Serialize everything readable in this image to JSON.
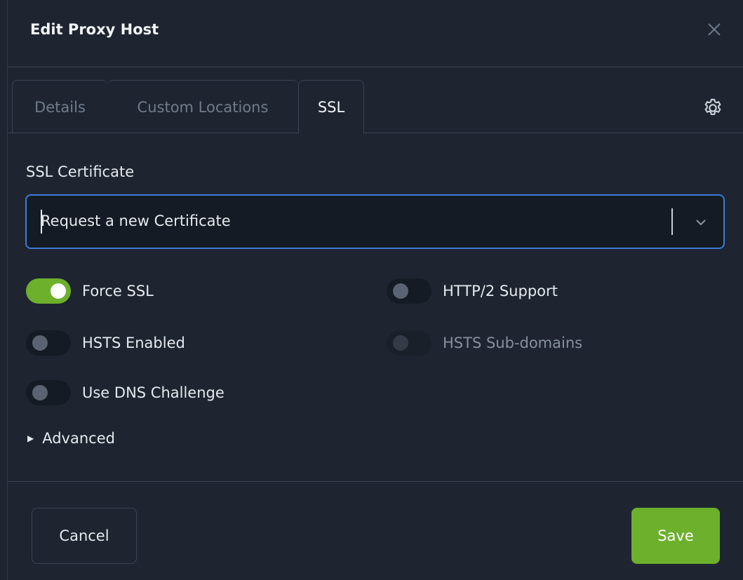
{
  "modal": {
    "title": "Edit Proxy Host"
  },
  "tabs": [
    {
      "label": "Details",
      "active": false
    },
    {
      "label": "Custom Locations",
      "active": false
    },
    {
      "label": "SSL",
      "active": true
    }
  ],
  "ssl": {
    "certificate_label": "SSL Certificate",
    "certificate_value": "Request a new Certificate",
    "toggles": {
      "force_ssl": {
        "label": "Force SSL",
        "on": true,
        "disabled": false
      },
      "http2": {
        "label": "HTTP/2 Support",
        "on": false,
        "disabled": false
      },
      "hsts": {
        "label": "HSTS Enabled",
        "on": false,
        "disabled": false
      },
      "hsts_sub": {
        "label": "HSTS Sub-domains",
        "on": false,
        "disabled": true
      },
      "dns_challenge": {
        "label": "Use DNS Challenge",
        "on": false,
        "disabled": false
      }
    },
    "advanced_label": "Advanced"
  },
  "footer": {
    "cancel_label": "Cancel",
    "save_label": "Save"
  },
  "icons": {
    "close": "close-icon",
    "settings": "gear-icon",
    "dropdown": "chevron-down-icon",
    "expand": "triangle-right-icon"
  },
  "colors": {
    "background": "#1e2530",
    "accent_green": "#6cb02c",
    "focus_blue": "#3d7bd9",
    "border": "#394455"
  }
}
